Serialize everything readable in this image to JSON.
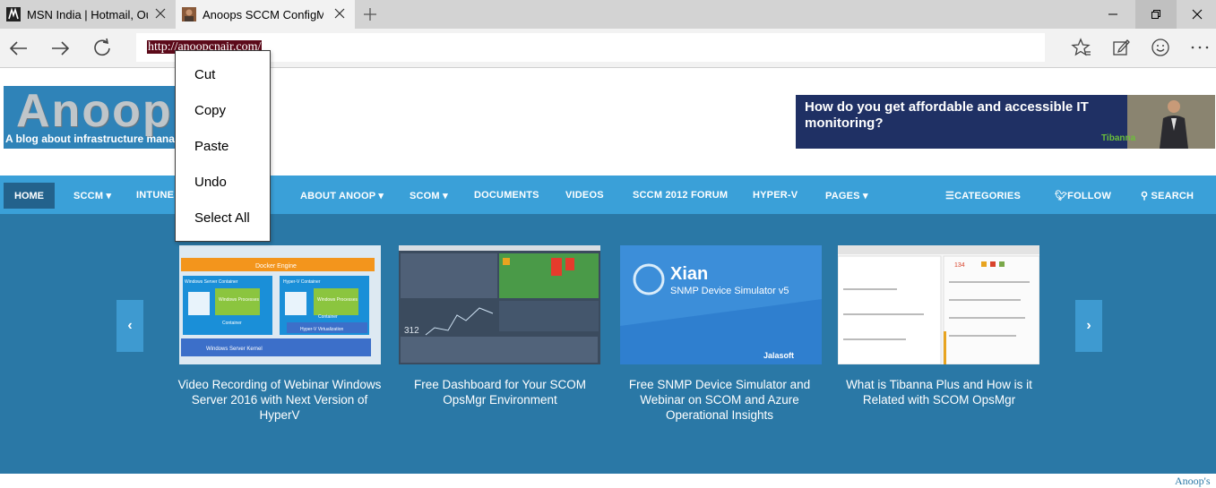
{
  "tabs": [
    {
      "title": "MSN India | Hotmail, Outlook"
    },
    {
      "title": "Anoops SCCM ConfigMgr"
    }
  ],
  "address": {
    "url": "http://anoopcnair.com/"
  },
  "context_menu": {
    "items": [
      "Cut",
      "Copy",
      "Paste",
      "Undo",
      "Select All"
    ]
  },
  "header": {
    "logo_text": "Anoop'",
    "logo_tagline": "A blog about infrastructure manag",
    "ad_text": "How do you get affordable and accessible IT monitoring?",
    "ad_brand": "Tibanna"
  },
  "nav": {
    "items": [
      "HOME",
      "SCCM",
      "INTUNE",
      "ABOUT ANOOP",
      "SCOM",
      "DOCUMENTS",
      "VIDEOS",
      "SCCM 2012 FORUM",
      "HYPER-V",
      "PAGES",
      "CATEGORIES",
      "FOLLOW",
      "SEARCH"
    ]
  },
  "slider": {
    "prev": "‹",
    "next": "›",
    "cards": [
      {
        "caption": "Video Recording of Webinar Windows Server 2016 with Next Version of HyperV"
      },
      {
        "caption": "Free Dashboard for Your SCOM OpsMgr Environment"
      },
      {
        "caption": "Free SNMP Device Simulator and Webinar on SCOM and Azure Operational Insights"
      },
      {
        "caption": "What is Tibanna Plus and How is it Related with SCOM OpsMgr"
      }
    ],
    "thumb1": {
      "bar": "Docker Engine",
      "box1": "Windows Server Container",
      "box2": "Hyper-V Container",
      "proc": "Windows Processes",
      "cont": "Container",
      "base": "Windows Server Kernel",
      "hv": "Hyper-V Virtualization"
    },
    "thumb3": {
      "brand": "Xian",
      "sub": "SNMP Device Simulator v5",
      "logo": "Jalasoft"
    }
  },
  "footer": {
    "text": "Anoop's"
  }
}
